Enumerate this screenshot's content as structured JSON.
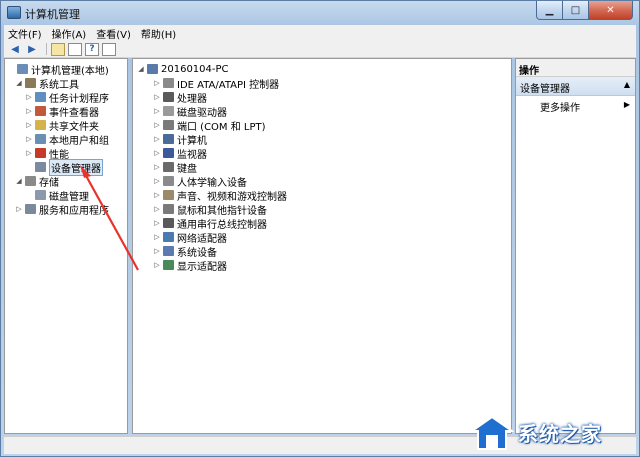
{
  "window": {
    "title": "计算机管理"
  },
  "menu": [
    "文件(F)",
    "操作(A)",
    "查看(V)",
    "帮助(H)"
  ],
  "left_tree": [
    {
      "label": "计算机管理(本地)",
      "indent": 0,
      "arrow": "",
      "icon": "computer-management-icon",
      "color": "#6b8db8"
    },
    {
      "label": "系统工具",
      "indent": 1,
      "arrow": "◢",
      "icon": "tools-icon",
      "color": "#8a7a5a"
    },
    {
      "label": "任务计划程序",
      "indent": 2,
      "arrow": "▷",
      "icon": "clock-icon",
      "color": "#5f8fc0"
    },
    {
      "label": "事件查看器",
      "indent": 2,
      "arrow": "▷",
      "icon": "event-viewer-icon",
      "color": "#c05a3a"
    },
    {
      "label": "共享文件夹",
      "indent": 2,
      "arrow": "▷",
      "icon": "shared-folder-icon",
      "color": "#d6b24a"
    },
    {
      "label": "本地用户和组",
      "indent": 2,
      "arrow": "▷",
      "icon": "users-icon",
      "color": "#6a8fb5"
    },
    {
      "label": "性能",
      "indent": 2,
      "arrow": "▷",
      "icon": "performance-icon",
      "color": "#c63a2a"
    },
    {
      "label": "设备管理器",
      "indent": 2,
      "arrow": "",
      "icon": "device-manager-icon",
      "color": "#7a8aa0",
      "selected": true
    },
    {
      "label": "存储",
      "indent": 1,
      "arrow": "◢",
      "icon": "storage-icon",
      "color": "#8a8a8a"
    },
    {
      "label": "磁盘管理",
      "indent": 2,
      "arrow": "",
      "icon": "disk-icon",
      "color": "#8a9aaa"
    },
    {
      "label": "服务和应用程序",
      "indent": 1,
      "arrow": "▷",
      "icon": "services-icon",
      "color": "#7a8a9a"
    }
  ],
  "device_tree": {
    "root": "20160104-PC",
    "items": [
      {
        "label": "IDE ATA/ATAPI 控制器",
        "icon": "ide-controller-icon",
        "color": "#8a8a8a"
      },
      {
        "label": "处理器",
        "icon": "processor-icon",
        "color": "#5a5a5a"
      },
      {
        "label": "磁盘驱动器",
        "icon": "disk-drive-icon",
        "color": "#9a9a9a"
      },
      {
        "label": "端口 (COM 和 LPT)",
        "icon": "port-icon",
        "color": "#7a7a7a"
      },
      {
        "label": "计算机",
        "icon": "computer-icon",
        "color": "#4a6a9a"
      },
      {
        "label": "监视器",
        "icon": "monitor-icon",
        "color": "#3a5a9a"
      },
      {
        "label": "键盘",
        "icon": "keyboard-icon",
        "color": "#6a6a6a"
      },
      {
        "label": "人体学输入设备",
        "icon": "hid-icon",
        "color": "#8a8a8a"
      },
      {
        "label": "声音、视频和游戏控制器",
        "icon": "sound-icon",
        "color": "#9a8a6a"
      },
      {
        "label": "鼠标和其他指针设备",
        "icon": "mouse-icon",
        "color": "#7a7a7a"
      },
      {
        "label": "通用串行总线控制器",
        "icon": "usb-icon",
        "color": "#5a5a5a"
      },
      {
        "label": "网络适配器",
        "icon": "network-adapter-icon",
        "color": "#4a7ab0"
      },
      {
        "label": "系统设备",
        "icon": "system-device-icon",
        "color": "#5a7ab0"
      },
      {
        "label": "显示适配器",
        "icon": "display-adapter-icon",
        "color": "#4a8a5a"
      }
    ]
  },
  "actions": {
    "header": "操作",
    "section": "设备管理器",
    "more": "更多操作"
  },
  "watermark": {
    "text": "系统之家"
  }
}
